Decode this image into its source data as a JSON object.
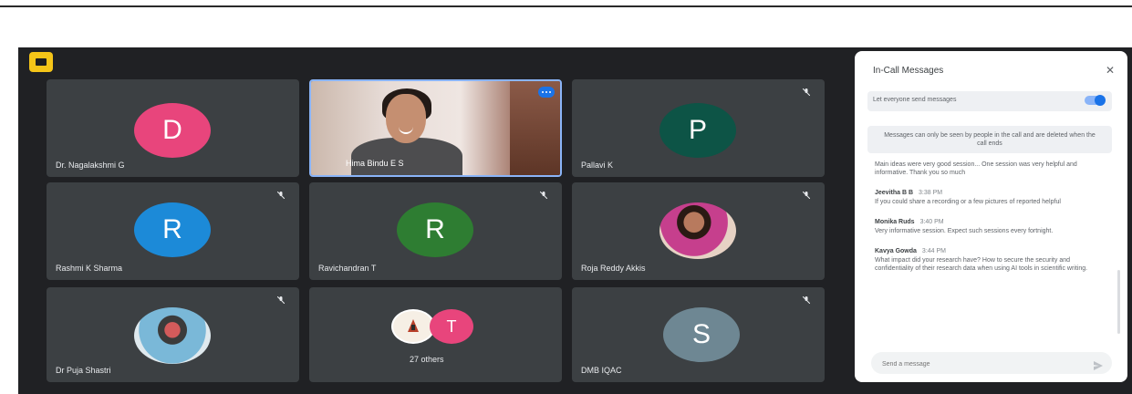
{
  "app": {
    "icon": "meet-app-icon"
  },
  "tiles": [
    {
      "name": "Dr. Nagalakshmi G",
      "initial": "D",
      "color": "#e8457c",
      "muted": false
    },
    {
      "name": "Hima Bindu E S",
      "type": "video",
      "muted": false
    },
    {
      "name": "Pallavi K",
      "initial": "P",
      "color": "#0d5446",
      "muted": true
    },
    {
      "name": "Rashmi K Sharma",
      "initial": "R",
      "color": "#1c8ad8",
      "muted": true
    },
    {
      "name": "Ravichandran T",
      "initial": "R",
      "color": "#2e7d32",
      "muted": true
    },
    {
      "name": "Roja Reddy Akkis",
      "type": "photo",
      "muted": true
    },
    {
      "name": "Dr Puja Shastri",
      "type": "photo",
      "muted": true
    },
    {
      "name": "27 others",
      "initial": "T",
      "color": "#e8457c",
      "type": "group",
      "muted": false
    },
    {
      "name": "DMB IQAC",
      "initial": "S",
      "color": "#6e8793",
      "muted": true
    }
  ],
  "panel": {
    "title": "In-Call Messages",
    "toggle_label": "Let everyone send messages",
    "toggle_on": true,
    "notice": "Messages can only be seen by people in the call and are deleted when the call ends",
    "messages": [
      {
        "sender": "",
        "time": "",
        "text": "Main ideas were very good session... One session was very helpful and informative. Thank you so much"
      },
      {
        "sender": "Jeevitha B B",
        "time": "3:38 PM",
        "text": "If you could share a recording or a few pictures of reported helpful"
      },
      {
        "sender": "Monika Ruds",
        "time": "3:40 PM",
        "text": "Very informative session. Expect such sessions every fortnight."
      },
      {
        "sender": "Kavya Gowda",
        "time": "3:44 PM",
        "text": "What impact did your research have? How to secure the security and confidentiality of their research data when using AI tools in scientific writing."
      }
    ],
    "compose_placeholder": "Send a message"
  }
}
